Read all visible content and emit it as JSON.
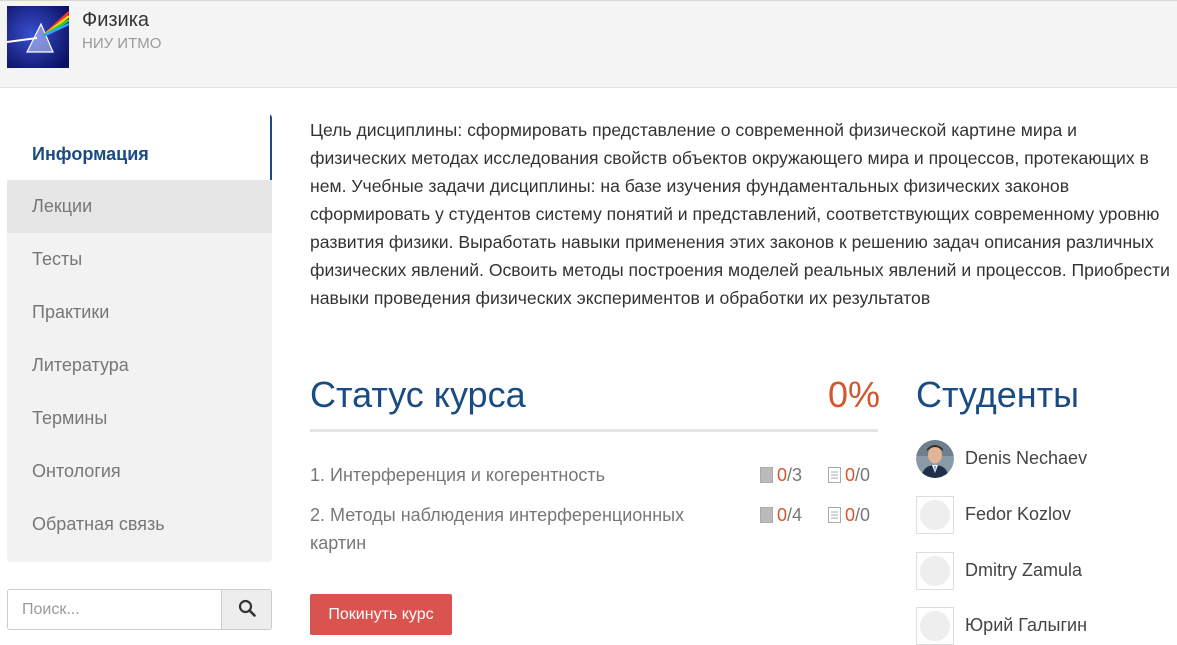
{
  "header": {
    "title": "Физика",
    "org": "НИУ ИТМО"
  },
  "sidebar": {
    "items": [
      {
        "label": "Информация",
        "active": true
      },
      {
        "label": "Лекции"
      },
      {
        "label": "Тесты"
      },
      {
        "label": "Практики"
      },
      {
        "label": "Литература"
      },
      {
        "label": "Термины"
      },
      {
        "label": "Онтология"
      },
      {
        "label": "Обратная связь"
      }
    ]
  },
  "search": {
    "placeholder": "Поиск...",
    "icon": "search-icon"
  },
  "main": {
    "description": "Цель дисциплины: сформировать представление о современной физической картине мира и физических методах исследования свойств объектов окружающего мира и процессов, протекающих в нем. Учебные задачи дисциплины: на базе изучения фундаментальных физических законов сформировать у студентов систему понятий и представлений, соответствующих современному уровню развития физики. Выработать навыки применения этих законов к решению задач описания различных физических явлений. Освоить методы построения моделей реальных явлений и процессов. Приобрести навыки проведения физических экспериментов и обработки их результатов",
    "status": {
      "title": "Статус курса",
      "percent": "0%",
      "lessons": [
        {
          "name": "1. Интерференция и когерентность",
          "a_done": "0",
          "a_total": "/3",
          "b_done": "0",
          "b_total": "/0"
        },
        {
          "name": "2. Методы наблюдения интерференционных картин",
          "a_done": "0",
          "a_total": "/4",
          "b_done": "0",
          "b_total": "/0"
        }
      ]
    },
    "leave_button": "Покинуть курс"
  },
  "students": {
    "title": "Студенты",
    "list": [
      {
        "name": "Denis Nechaev",
        "has_photo": true
      },
      {
        "name": "Fedor Kozlov"
      },
      {
        "name": "Dmitry Zamula"
      },
      {
        "name": "Юрий Галыгин"
      }
    ]
  },
  "colors": {
    "accent": "#1a4b82",
    "orange": "#d2572e",
    "danger": "#d9534f"
  }
}
